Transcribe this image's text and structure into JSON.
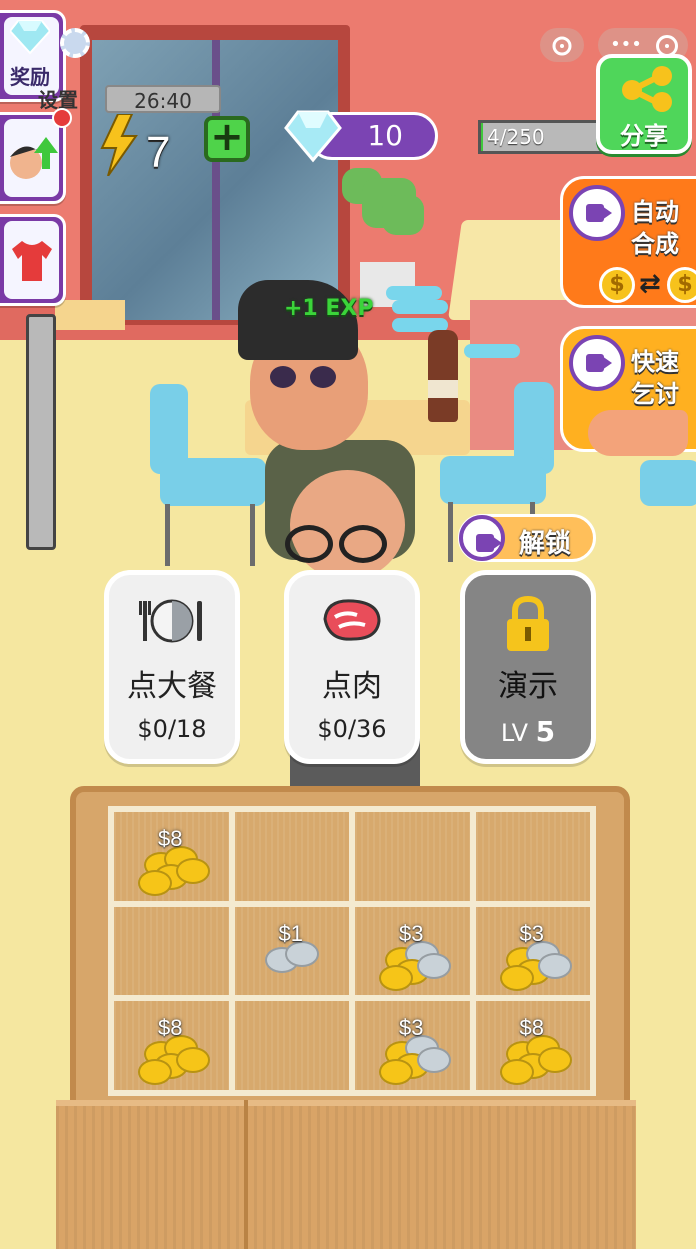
{
  "hud": {
    "timer": "26:40",
    "energy": "7",
    "gems": "10",
    "exp_progress": "4/250",
    "exp_fraction": 0.016
  },
  "side_menu": {
    "reward_label": "奖励",
    "settings_label": "设置"
  },
  "right_buttons": {
    "share_label": "分享",
    "auto_merge_line1": "自动",
    "auto_merge_line2": "合成",
    "quick_beg_line1": "快速",
    "quick_beg_line2": "乞讨",
    "unlock_label": "解锁"
  },
  "floating_text": "+1 EXP",
  "orders": [
    {
      "title": "点大餐",
      "progress": "$0/18",
      "icon": "plate-cutlery-icon"
    },
    {
      "title": "点肉",
      "progress": "$0/36",
      "icon": "meat-steak-icon"
    },
    {
      "title": "演示",
      "level_prefix": "LV",
      "level": "5",
      "icon": "padlock-icon"
    }
  ],
  "coin_grid": {
    "rows": 3,
    "cols": 4,
    "cells": [
      {
        "row": 0,
        "col": 0,
        "price": "$8",
        "type": "gold"
      },
      {
        "row": 0,
        "col": 1,
        "price": "",
        "type": "empty"
      },
      {
        "row": 0,
        "col": 2,
        "price": "",
        "type": "empty"
      },
      {
        "row": 0,
        "col": 3,
        "price": "",
        "type": "empty"
      },
      {
        "row": 1,
        "col": 0,
        "price": "",
        "type": "empty"
      },
      {
        "row": 1,
        "col": 1,
        "price": "$1",
        "type": "silver"
      },
      {
        "row": 1,
        "col": 2,
        "price": "$3",
        "type": "mixed"
      },
      {
        "row": 1,
        "col": 3,
        "price": "$3",
        "type": "mixed"
      },
      {
        "row": 2,
        "col": 0,
        "price": "$8",
        "type": "gold"
      },
      {
        "row": 2,
        "col": 1,
        "price": "",
        "type": "empty"
      },
      {
        "row": 2,
        "col": 2,
        "price": "$3",
        "type": "mixed"
      },
      {
        "row": 2,
        "col": 3,
        "price": "$8",
        "type": "gold"
      }
    ]
  },
  "colors": {
    "wall": "#ec7b6f",
    "floor": "#f5e7a0",
    "purple": "#7b44b3",
    "green": "#4fd65a",
    "orange": "#ff7a1a"
  }
}
